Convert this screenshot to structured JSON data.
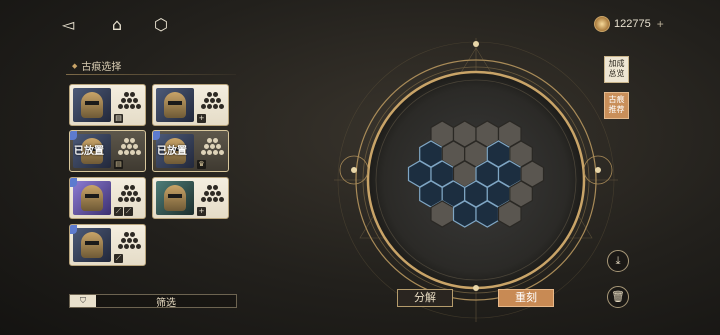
{
  "topbar": {
    "back_icon": "back-arrow-icon",
    "home_icon": "home-icon",
    "cube_icon": "cube-icon",
    "currency_icon": "coin-icon",
    "currency_amount": "122775",
    "currency_plus": "+"
  },
  "panel": {
    "title": "古痕选择",
    "cards": [
      {
        "placed": false,
        "placed_label": "",
        "portrait": "blue",
        "badge": "▤"
      },
      {
        "placed": false,
        "placed_label": "",
        "portrait": "blue",
        "badge": "+"
      },
      {
        "placed": true,
        "placed_label": "已放置",
        "portrait": "blue",
        "badge": "▤"
      },
      {
        "placed": true,
        "placed_label": "已放置",
        "portrait": "blue",
        "badge": "♛"
      },
      {
        "placed": false,
        "placed_label": "",
        "portrait": "purple",
        "badge": "⟋"
      },
      {
        "placed": false,
        "placed_label": "",
        "portrait": "teal",
        "badge": "+"
      },
      {
        "placed": false,
        "placed_label": "",
        "portrait": "blue",
        "badge": "⟋"
      }
    ],
    "filter_label": "筛选"
  },
  "side_buttons": {
    "overview": "加成总览",
    "recommend": "古痕推荐"
  },
  "actions": {
    "decompose": "分解",
    "reforge": "重刻"
  },
  "colors": {
    "accent": "#c88a54",
    "gold": "#c9a468",
    "card_bg": "#f4eee0"
  }
}
